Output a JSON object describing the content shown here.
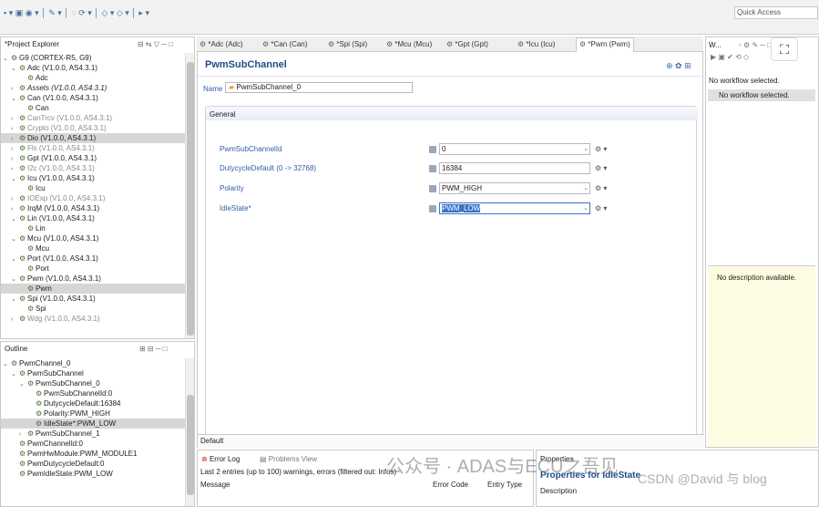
{
  "toolbar": {
    "quick_access": "Quick Access"
  },
  "project_explorer": {
    "title": "*Project Explorer",
    "items": [
      {
        "tw": "⌄",
        "label": "G9 (CORTEX-R5, G9)",
        "cls": "",
        "indent": 0
      },
      {
        "tw": "⌄",
        "label": "Adc (V1.0.0, AS4.3.1)",
        "cls": "",
        "indent": 1
      },
      {
        "tw": "",
        "label": "Adc",
        "cls": "",
        "indent": 2
      },
      {
        "tw": "›",
        "label": "Assets (V1.0.0, AS4.3.1)",
        "cls": "it",
        "indent": 1
      },
      {
        "tw": "⌄",
        "label": "Can (V1.0.0, AS4.3.1)",
        "cls": "",
        "indent": 1
      },
      {
        "tw": "",
        "label": "Can",
        "cls": "",
        "indent": 2
      },
      {
        "tw": "›",
        "label": "CanTrcv (V1.0.0, AS4.3.1)",
        "cls": "grey",
        "indent": 1
      },
      {
        "tw": "›",
        "label": "Crypto (V1.0.0, AS4.3.1)",
        "cls": "grey",
        "indent": 1
      },
      {
        "tw": "›",
        "label": "Dio (V1.0.0, AS4.3.1)",
        "cls": "sel",
        "indent": 1
      },
      {
        "tw": "›",
        "label": "Fls (V1.0.0, AS4.3.1)",
        "cls": "grey",
        "indent": 1
      },
      {
        "tw": "›",
        "label": "Gpt (V1.0.0, AS4.3.1)",
        "cls": "",
        "indent": 1
      },
      {
        "tw": "›",
        "label": "I2c (V1.0.0, AS4.3.1)",
        "cls": "grey",
        "indent": 1
      },
      {
        "tw": "⌄",
        "label": "Icu (V1.0.0, AS4.3.1)",
        "cls": "",
        "indent": 1
      },
      {
        "tw": "",
        "label": "Icu",
        "cls": "",
        "indent": 2
      },
      {
        "tw": "›",
        "label": "IOExp (V1.0.0, AS4.3.1)",
        "cls": "grey",
        "indent": 1
      },
      {
        "tw": "›",
        "label": "IrqM (V1.0.0, AS4.3.1)",
        "cls": "",
        "indent": 1
      },
      {
        "tw": "⌄",
        "label": "Lin (V1.0.0, AS4.3.1)",
        "cls": "",
        "indent": 1
      },
      {
        "tw": "",
        "label": "Lin",
        "cls": "",
        "indent": 2
      },
      {
        "tw": "⌄",
        "label": "Mcu (V1.0.0, AS4.3.1)",
        "cls": "",
        "indent": 1
      },
      {
        "tw": "",
        "label": "Mcu",
        "cls": "",
        "indent": 2
      },
      {
        "tw": "⌄",
        "label": "Port (V1.0.0, AS4.3.1)",
        "cls": "",
        "indent": 1
      },
      {
        "tw": "",
        "label": "Port",
        "cls": "",
        "indent": 2
      },
      {
        "tw": "⌄",
        "label": "Pwm (V1.0.0, AS4.3.1)",
        "cls": "",
        "indent": 1
      },
      {
        "tw": "",
        "label": "Pwm",
        "cls": "sel",
        "indent": 2
      },
      {
        "tw": "⌄",
        "label": "Spi (V1.0.0, AS4.3.1)",
        "cls": "",
        "indent": 1
      },
      {
        "tw": "",
        "label": "Spi",
        "cls": "",
        "indent": 2
      },
      {
        "tw": "›",
        "label": "Wdg (V1.0.0, AS4.3.1)",
        "cls": "grey",
        "indent": 1
      }
    ]
  },
  "outline": {
    "title": "Outline",
    "items": [
      {
        "tw": "⌄",
        "label": "PwmChannel_0",
        "cls": "",
        "indent": 0
      },
      {
        "tw": "⌄",
        "label": "PwmSubChannel",
        "cls": "",
        "indent": 1
      },
      {
        "tw": "⌄",
        "label": "PwmSubChannel_0",
        "cls": "",
        "indent": 2
      },
      {
        "tw": "",
        "label": "PwmSubChannelId:0",
        "cls": "",
        "indent": 3
      },
      {
        "tw": "",
        "label": "DutycycleDefault:16384",
        "cls": "",
        "indent": 3
      },
      {
        "tw": "",
        "label": "Polarity:PWM_HIGH",
        "cls": "",
        "indent": 3
      },
      {
        "tw": "",
        "label": "IdleState*:PWM_LOW",
        "cls": "sel",
        "indent": 3
      },
      {
        "tw": "›",
        "label": "PwmSubChannel_1",
        "cls": "",
        "indent": 2
      },
      {
        "tw": "",
        "label": "PwmChannelId:0",
        "cls": "",
        "indent": 1
      },
      {
        "tw": "",
        "label": "PwmHwModule:PWM_MODULE1",
        "cls": "",
        "indent": 1
      },
      {
        "tw": "",
        "label": "PwmDutycycleDefault:0",
        "cls": "",
        "indent": 1
      },
      {
        "tw": "",
        "label": "PwmIdleState:PWM_LOW",
        "cls": "",
        "indent": 1
      }
    ]
  },
  "editor": {
    "tabs": [
      "*Adc (Adc)",
      "*Can (Can)",
      "*Spi (Spi)",
      "*Mcu (Mcu)",
      "*Gpt (Gpt)",
      "*Icu (Icu)",
      "*Pwm (Pwm)"
    ],
    "heading": "PwmSubChannel",
    "name_label": "Name",
    "name_value": "PwmSubChannel_0",
    "section": "General",
    "fields": [
      {
        "label": "PwmSubChannelId",
        "value": "0",
        "dropdown": true
      },
      {
        "label": "DutycycleDefault (0 -> 32768)",
        "value": "16384",
        "dropdown": false
      },
      {
        "label": "Polarity",
        "value": "PWM_HIGH",
        "dropdown": true
      },
      {
        "label": "IdleState*",
        "value": "PWM_LOW",
        "dropdown": true
      }
    ],
    "bottom_tab": "Default"
  },
  "workflow": {
    "title": "W...",
    "message": "No workflow selected.",
    "message2": "No workflow selected.",
    "description": "No description available."
  },
  "error_log": {
    "tab1": "Error Log",
    "tab2": "Problems View",
    "summary": "Last 2 entries (up to 100) warnings, errors (filtered out: Infos)",
    "col1": "Message",
    "col2": "Error Code",
    "col3": "Entry Type"
  },
  "properties": {
    "tab": "Properties",
    "title": "Properties for IdleState",
    "col": "Description"
  },
  "watermark": "公众号 · ADAS与ECU之吾见",
  "watermark2": "CSDN @David 与 blog"
}
